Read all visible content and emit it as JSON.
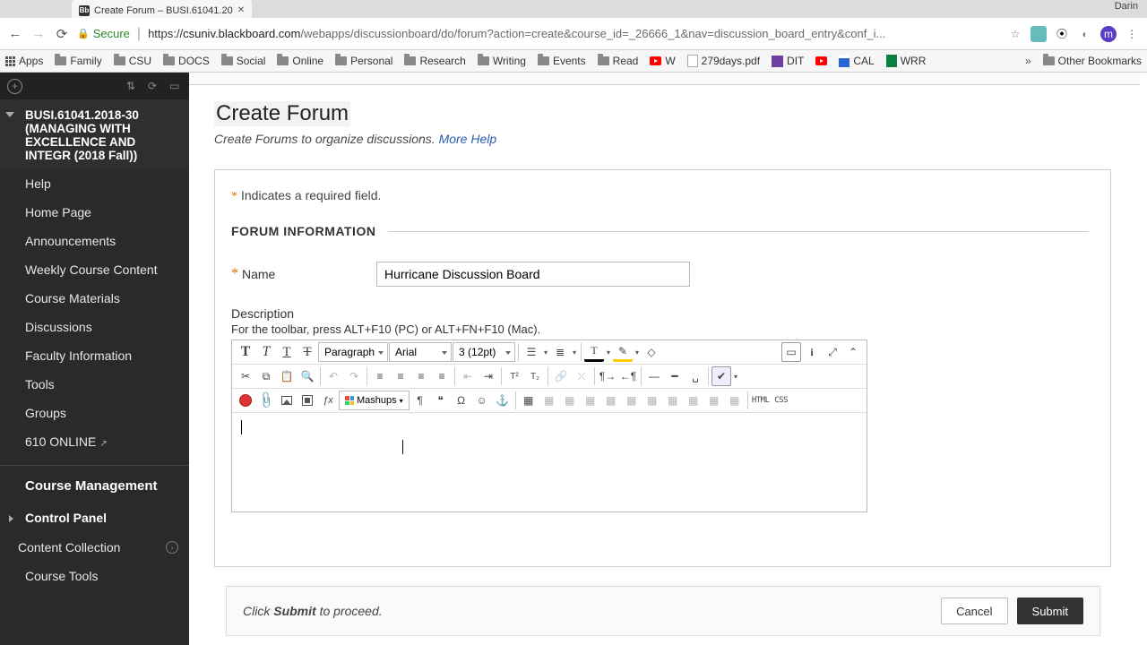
{
  "mac_user": "Darin",
  "tab": {
    "title": "Create Forum – BUSI.61041.20"
  },
  "url": {
    "secure_label": "Secure",
    "host": "csuniv.blackboard.com",
    "rest": "/webapps/discussionboard/do/forum?action=create&course_id=_26666_1&nav=discussion_board_entry&conf_i..."
  },
  "bookmarks": {
    "apps": "Apps",
    "items": [
      "Family",
      "CSU",
      "DOCS",
      "Social",
      "Online",
      "Personal",
      "Research",
      "Writing",
      "Events",
      "Read"
    ],
    "w": "W",
    "pdf": "279days.pdf",
    "dit": "DIT",
    "cal": "CAL",
    "wrr": "WRR",
    "other": "Other Bookmarks"
  },
  "course": {
    "code": "BUSI.61041.2018-30",
    "name": "(MANAGING WITH EXCELLENCE AND INTEGR (2018 Fall))"
  },
  "nav": [
    "Help",
    "Home Page",
    "Announcements",
    "Weekly Course Content",
    "Course Materials",
    "Discussions",
    "Faculty Information",
    "Tools",
    "Groups",
    "610 ONLINE"
  ],
  "cm": {
    "head": "Course Management",
    "cp": "Control Panel",
    "cc": "Content Collection",
    "ct": "Course Tools"
  },
  "page": {
    "title": "Create Forum",
    "subtitle": "Create Forums to organize discussions. ",
    "more_help": "More Help",
    "required_note": "Indicates a required field.",
    "section": "FORUM INFORMATION",
    "name_label": "Name",
    "name_value": "Hurricane Discussion Board",
    "desc_label": "Description",
    "toolbar_hint": "For the toolbar, press ALT+F10 (PC) or ALT+FN+F10 (Mac)."
  },
  "rte": {
    "format": "Paragraph",
    "font": "Arial",
    "size": "3 (12pt)",
    "mashups": "Mashups",
    "html": "HTML",
    "css": "CSS"
  },
  "submit": {
    "proceed_pre": "Click ",
    "proceed_bold": "Submit",
    "proceed_post": " to proceed.",
    "cancel": "Cancel",
    "submit": "Submit"
  }
}
